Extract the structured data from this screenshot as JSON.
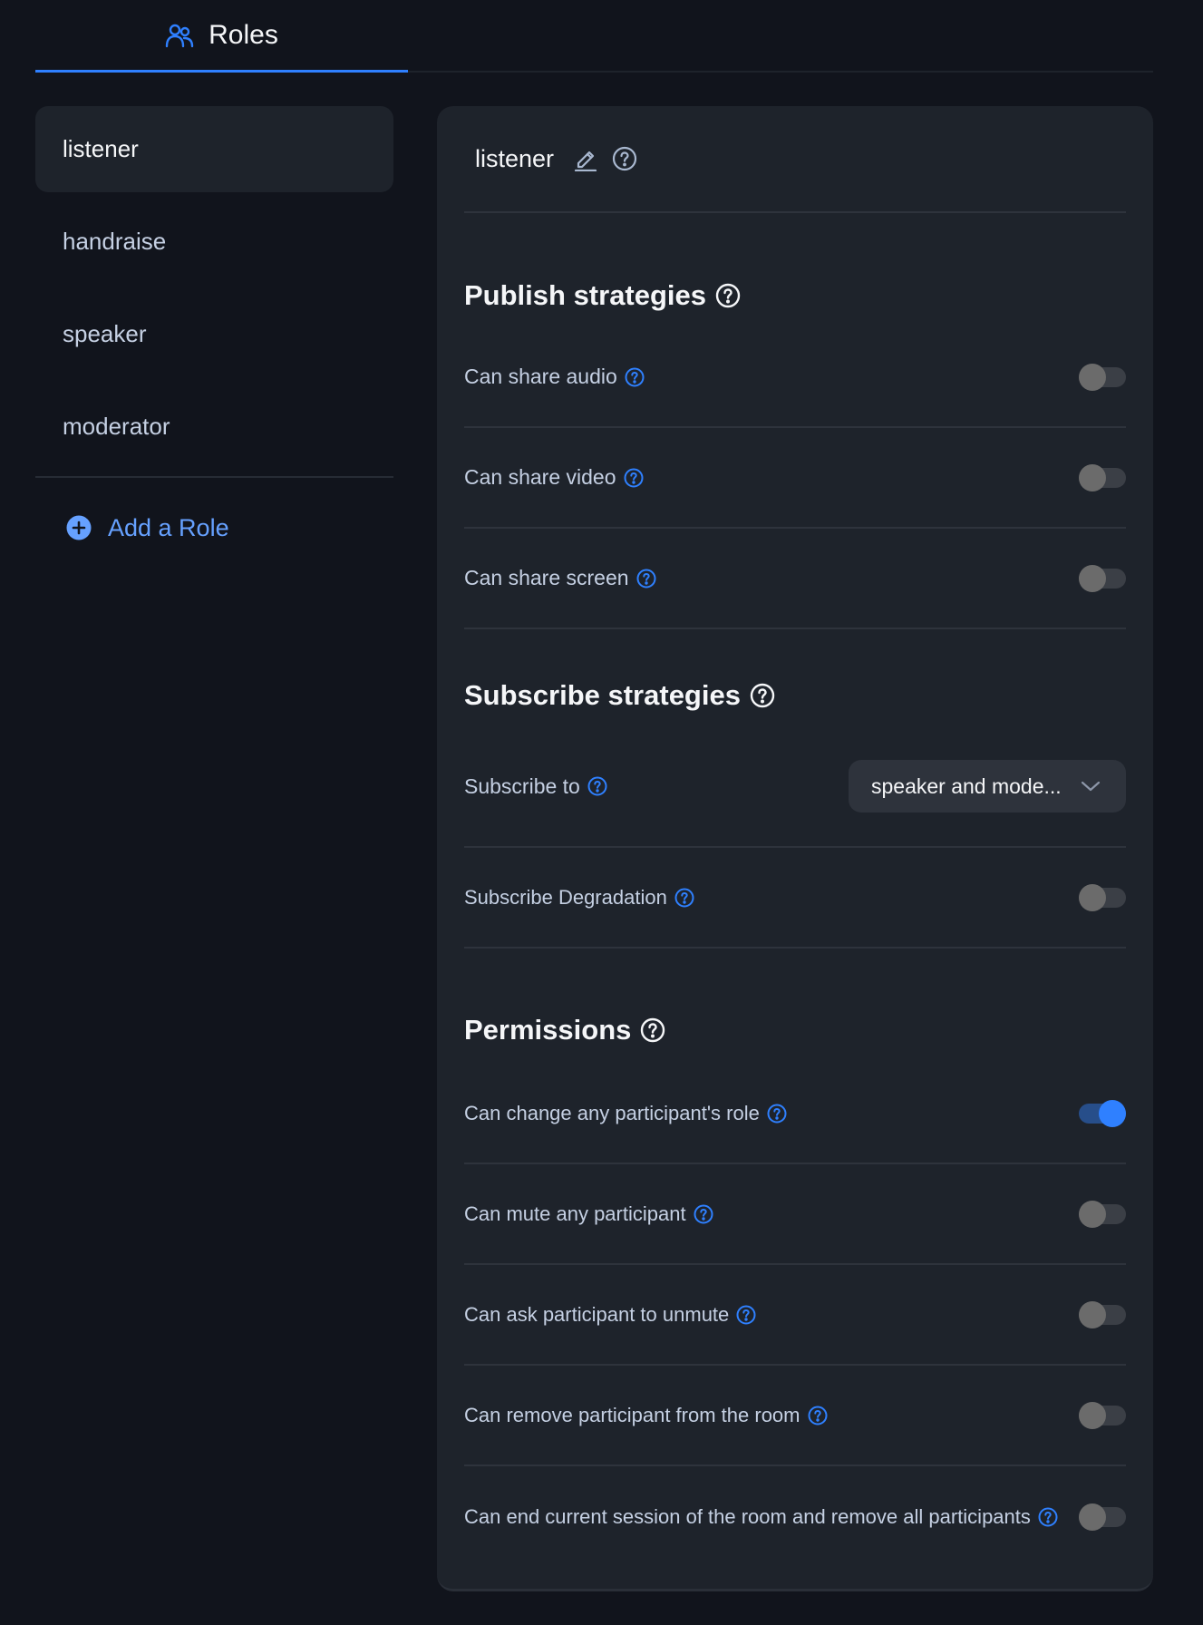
{
  "tabs": [
    {
      "label": "Roles",
      "icon": "users-icon",
      "active": true
    }
  ],
  "sidebar": {
    "roles": [
      {
        "label": "listener",
        "active": true
      },
      {
        "label": "handraise",
        "active": false
      },
      {
        "label": "speaker",
        "active": false
      },
      {
        "label": "moderator",
        "active": false
      }
    ],
    "add_role_label": "Add a Role"
  },
  "panel": {
    "role_name": "listener",
    "publish": {
      "title": "Publish strategies",
      "rows": [
        {
          "label": "Can share audio",
          "enabled": false
        },
        {
          "label": "Can share video",
          "enabled": false
        },
        {
          "label": "Can share screen",
          "enabled": false
        }
      ]
    },
    "subscribe": {
      "title": "Subscribe strategies",
      "subscribe_to": {
        "label": "Subscribe to",
        "value": "speaker and mode..."
      },
      "degradation": {
        "label": "Subscribe Degradation",
        "enabled": false
      }
    },
    "permissions": {
      "title": "Permissions",
      "rows": [
        {
          "label": "Can change any participant's role",
          "enabled": true
        },
        {
          "label": "Can mute any participant",
          "enabled": false
        },
        {
          "label": "Can ask participant to unmute",
          "enabled": false
        },
        {
          "label": "Can remove participant from the room",
          "enabled": false
        },
        {
          "label": "Can end current session of the room and remove all participants",
          "enabled": false
        }
      ]
    }
  },
  "colors": {
    "accent": "#2f80ff",
    "background": "#11141c",
    "panel": "#1e232b",
    "toggle_off_knob": "#6b6b6b",
    "link": "#66a1ff"
  }
}
